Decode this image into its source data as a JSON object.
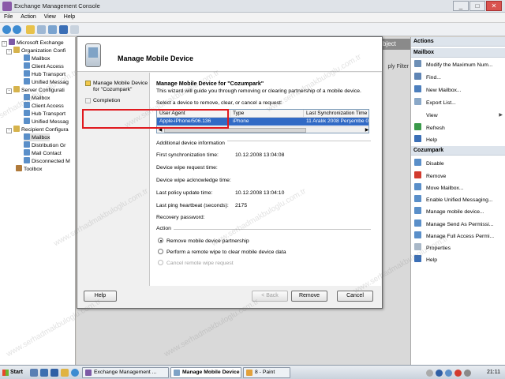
{
  "window": {
    "title": "Exchange Management Console",
    "min": "_",
    "max": "□",
    "close": "✕"
  },
  "menu": [
    "File",
    "Action",
    "View",
    "Help"
  ],
  "tree": {
    "root": "Microsoft Exchange",
    "nodes": [
      "Organization Confi",
      "Mailbox",
      "Client Access",
      "Hub Transport",
      "Unified Messag",
      "Server Configurati",
      "Mailbox",
      "Client Access",
      "Hub Transport",
      "Unified Messag",
      "Recipient Configura",
      "Mailbox",
      "Distribution Gr",
      "Mail Contact",
      "Disconnected M",
      "Toolbox"
    ]
  },
  "center": {
    "tab_fragment": "bject",
    "filter_fragment": "ply Filter"
  },
  "actions": {
    "header": "Actions",
    "section1": "Mailbox",
    "items1": [
      "Modify the Maximum Num...",
      "Find...",
      "New Mailbox...",
      "Export List...",
      "View",
      "Refresh",
      "Help"
    ],
    "section2": "Cozumpark",
    "items2": [
      "Disable",
      "Remove",
      "Move Mailbox...",
      "Enable Unified Messaging...",
      "Manage mobile device...",
      "Manage Send As Permissi...",
      "Manage Full Access Permi...",
      "Properties",
      "Help"
    ]
  },
  "dialog": {
    "title": "Manage Mobile Device",
    "steps": [
      "Manage Mobile Device for \"Cozumpark\"",
      "Completion"
    ],
    "heading": "Manage Mobile Device for \"Cozumpark\"",
    "description": "This wizard will guide you through removing or clearing partnership of a mobile device.",
    "select_label": "Select a device to remove, clear, or cancel a request:",
    "columns": [
      "User Agent",
      "Type",
      "Last Synchronization Time"
    ],
    "row": [
      "Apple-iPhone/506.136",
      "iPhone",
      "11 Aralık 2008 Perşembe 0"
    ],
    "additional": "Additional device information",
    "fields": [
      {
        "label": "First synchronization time:",
        "value": "10.12.2008 13:04:08"
      },
      {
        "label": "Device wipe request time:",
        "value": ""
      },
      {
        "label": "Device wipe acknowledge time:",
        "value": ""
      },
      {
        "label": "Last policy update time:",
        "value": "10.12.2008 13:04:10"
      },
      {
        "label": "Last ping heartbeat (seconds):",
        "value": "2175"
      },
      {
        "label": "Recovery password:",
        "value": ""
      }
    ],
    "action_label": "Action",
    "radios": [
      "Remove mobile device partnership",
      "Perform a remote wipe to clear mobile device data",
      "Cancel remote wipe request"
    ],
    "buttons": {
      "help": "Help",
      "back": "< Back",
      "remove": "Remove",
      "cancel": "Cancel"
    }
  },
  "taskbar": {
    "start": "Start",
    "tasks": [
      "Exchange Management ...",
      "Manage Mobile Device",
      "8 - Paint"
    ],
    "clock": "21:11"
  },
  "watermark": "www.serhadmakbuloglu.com.tr",
  "colors": {
    "selection": "#316ac5",
    "highlight_box": "#e0191e",
    "step_current": "#f2c84b"
  }
}
